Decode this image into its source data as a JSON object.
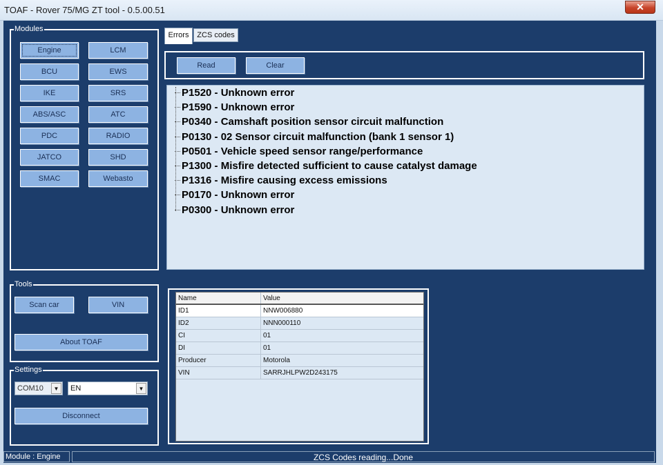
{
  "window": {
    "title": "TOAF - Rover 75/MG ZT tool - 0.5.00.51",
    "close_glyph": "✕"
  },
  "modules": {
    "legend": "Modules",
    "buttons": [
      "Engine",
      "LCM",
      "BCU",
      "EWS",
      "IKE",
      "SRS",
      "ABS/ASC",
      "ATC",
      "PDC",
      "RADIO",
      "JATCO",
      "SHD",
      "SMAC",
      "Webasto"
    ],
    "active": "Engine"
  },
  "tools": {
    "legend": "Tools",
    "scan_car": "Scan car",
    "vin": "VIN",
    "about": "About TOAF"
  },
  "settings": {
    "legend": "Settings",
    "port": "COM10",
    "language": "EN",
    "disconnect": "Disconnect"
  },
  "tabs": {
    "errors": "Errors",
    "zcs": "ZCS codes",
    "selected": "Errors"
  },
  "actions": {
    "read": "Read",
    "clear": "Clear"
  },
  "errors": [
    "P1520 - Unknown error",
    "P1590 - Unknown error",
    "P0340 - Camshaft position sensor circuit malfunction",
    "P0130 - 02 Sensor circuit malfunction (bank 1 sensor 1)",
    "P0501 - Vehicle speed sensor range/performance",
    "P1300 - Misfire detected sufficient to cause catalyst damage",
    "P1316 - Misfire causing excess emissions",
    "P0170 - Unknown error",
    "P0300 - Unknown error"
  ],
  "info_grid": {
    "headers": {
      "name": "Name",
      "value": "Value"
    },
    "rows": [
      {
        "name": "ID1",
        "value": "NNW006880"
      },
      {
        "name": "ID2",
        "value": "NNN000110"
      },
      {
        "name": "CI",
        "value": "01"
      },
      {
        "name": "DI",
        "value": "01"
      },
      {
        "name": "Producer",
        "value": "Motorola"
      },
      {
        "name": "VIN",
        "value": "SARRJHLPW2D243175"
      }
    ]
  },
  "status": {
    "module": "Module : Engine",
    "message": "ZCS Codes reading...Done"
  },
  "colors": {
    "background": "#1c3d6b",
    "button": "#8db3e2",
    "list_bg": "#dce8f4",
    "close": "#c7442a"
  },
  "icons": {
    "close": "close-icon",
    "dropdown": "chevron-down-icon"
  }
}
